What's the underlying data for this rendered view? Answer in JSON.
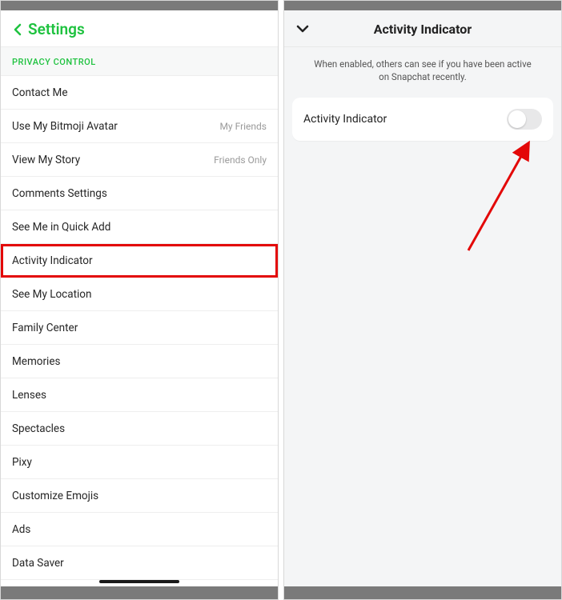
{
  "left": {
    "header_title": "Settings",
    "section_label": "PRIVACY CONTROL",
    "rows": [
      {
        "label": "Contact Me",
        "value": ""
      },
      {
        "label": "Use My Bitmoji Avatar",
        "value": "My Friends"
      },
      {
        "label": "View My Story",
        "value": "Friends Only"
      },
      {
        "label": "Comments Settings",
        "value": ""
      },
      {
        "label": "See Me in Quick Add",
        "value": ""
      },
      {
        "label": "Activity Indicator",
        "value": "",
        "highlight": true
      },
      {
        "label": "See My Location",
        "value": ""
      },
      {
        "label": "Family Center",
        "value": ""
      },
      {
        "label": "Memories",
        "value": ""
      },
      {
        "label": "Lenses",
        "value": ""
      },
      {
        "label": "Spectacles",
        "value": ""
      },
      {
        "label": "Pixy",
        "value": ""
      },
      {
        "label": "Customize Emojis",
        "value": ""
      },
      {
        "label": "Ads",
        "value": ""
      },
      {
        "label": "Data Saver",
        "value": ""
      }
    ]
  },
  "right": {
    "title": "Activity Indicator",
    "description": "When enabled, others can see if you have been active on Snapchat recently.",
    "toggle_label": "Activity Indicator",
    "toggle_on": false
  },
  "colors": {
    "accent": "#1ec23f",
    "highlight": "#e30808",
    "arrow": "#e30808"
  }
}
